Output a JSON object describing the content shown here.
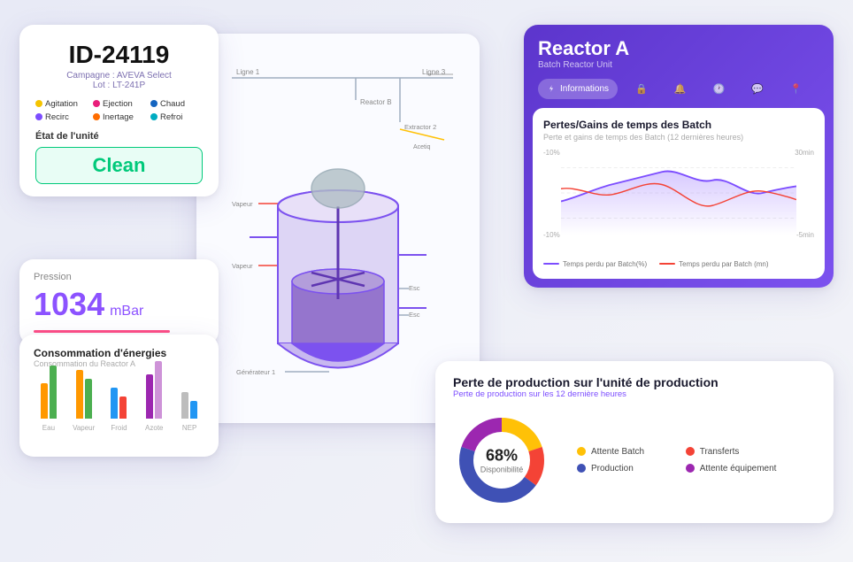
{
  "id_card": {
    "title": "ID-24119",
    "campaign": "Campagne : AVEVA Select",
    "lot": "Lot : LT-241P",
    "tags": [
      {
        "label": "Agitation",
        "color": "yellow"
      },
      {
        "label": "Ejection",
        "color": "pink"
      },
      {
        "label": "Chaud",
        "color": "blue"
      },
      {
        "label": "Recirc",
        "color": "purple"
      },
      {
        "label": "Inertage",
        "color": "orange"
      },
      {
        "label": "Refroi",
        "color": "teal"
      }
    ],
    "state_label": "État de l'unité",
    "state_value": "Clean"
  },
  "pressure_card": {
    "label": "Pression",
    "value": "1034",
    "unit": "mBar"
  },
  "energy_card": {
    "title": "Consommation d'énergies",
    "subtitle": "Consommation du Reactor A",
    "labels": [
      "Eau",
      "Vapeur",
      "Froid",
      "Azote",
      "NEP"
    ]
  },
  "reactor_card": {
    "title": "Reactor A",
    "subtitle": "Batch Reactor Unit",
    "tabs": [
      {
        "label": "Informations",
        "active": true
      },
      {
        "label": "lock",
        "icon": true
      },
      {
        "label": "sound",
        "icon": true
      },
      {
        "label": "time",
        "icon": true
      },
      {
        "label": "chat",
        "icon": true
      },
      {
        "label": "location",
        "icon": true
      }
    ],
    "chart": {
      "title": "Pertes/Gains de temps des Batch",
      "subtitle": "Perte et gains de temps des Batch (12 dernières heures)",
      "y_left": [
        "-10%",
        "",
        "-10%"
      ],
      "y_right": [
        "30min",
        "",
        "-5min"
      ],
      "legend": [
        {
          "label": "Temps perdu par Batch(%)",
          "color": "#7c4dff"
        },
        {
          "label": "Temps perdu par Batch (mn)",
          "color": "#f44336"
        }
      ]
    }
  },
  "production_card": {
    "title": "Perte de production sur l'unité de production",
    "subtitle": "Perte de production sur les 12 dernière heures",
    "donut": {
      "percent": "68%",
      "label": "Disponibilité",
      "segments": [
        {
          "label": "Attente Batch",
          "color": "#ffc107",
          "value": 20
        },
        {
          "label": "Transferts",
          "color": "#f44336",
          "value": 15
        },
        {
          "label": "Production",
          "color": "#3f51b5",
          "value": 45
        },
        {
          "label": "Attente équipement",
          "color": "#9c27b0",
          "value": 20
        }
      ]
    }
  }
}
